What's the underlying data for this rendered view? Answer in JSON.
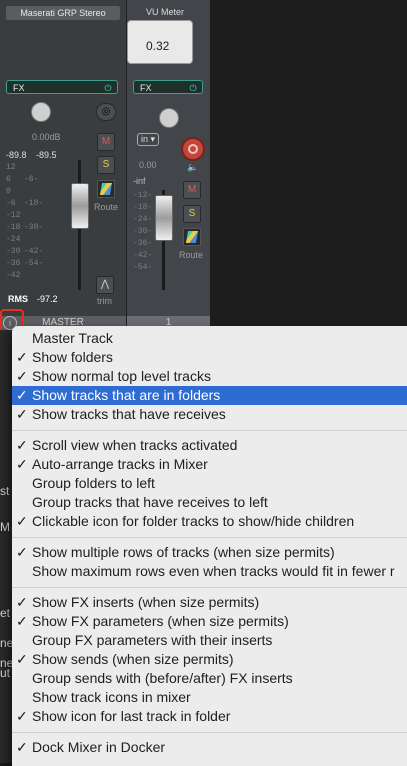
{
  "mixer": {
    "master": {
      "fx_name": "Maserati GRP Stereo",
      "fx_label": "FX",
      "volume": "0.00dB",
      "peak_left": "-89.8",
      "peak_right": "-89.5",
      "mute_label": "M",
      "solo_label": "S",
      "route_label": "Route",
      "trim_label": "trim",
      "rms_label": "RMS",
      "rms_value": "-97.2",
      "name": "MASTER",
      "scale_left": "12\n6\n0\n-6\n-12\n-18\n-24\n-30\n-36\n-42",
      "scale_right": "\n-6-\n\n-18-\n\n-30-\n\n-42-\n-54-"
    },
    "track1": {
      "vu_title": "VU Meter",
      "vu_value": "0.32",
      "fx_label": "FX",
      "input_label": "in",
      "volume": "0.00",
      "inf_label": "-inf",
      "mute_label": "M",
      "solo_label": "S",
      "route_label": "Route",
      "number": "1",
      "scale": "-12-\n-18-\n-24-\n-30-\n-36-\n-42-\n-54-"
    },
    "colors": {
      "fx_accent": "#47d3b1",
      "mute": "#e4584c",
      "solo": "#e7cf4a",
      "highlight": "#2e6bd2",
      "annotation": "#ee2b1e"
    }
  },
  "menu": {
    "items": [
      {
        "checked": false,
        "label": "Master Track"
      },
      {
        "checked": true,
        "label": "Show folders"
      },
      {
        "checked": true,
        "label": "Show normal top level tracks"
      },
      {
        "checked": true,
        "label": "Show tracks that are in folders",
        "highlighted": true
      },
      {
        "checked": true,
        "label": "Show tracks that have receives"
      },
      {
        "checked": true,
        "label": "Scroll view when tracks activated"
      },
      {
        "checked": true,
        "label": "Auto-arrange tracks in Mixer"
      },
      {
        "checked": false,
        "label": "Group folders to left"
      },
      {
        "checked": false,
        "label": "Group tracks that have receives to left"
      },
      {
        "checked": true,
        "label": "Clickable icon for folder tracks to show/hide children"
      },
      {
        "checked": true,
        "label": "Show multiple rows of tracks (when size permits)"
      },
      {
        "checked": false,
        "label": "Show maximum rows even when tracks would fit in fewer r"
      },
      {
        "checked": true,
        "label": "Show FX inserts (when size permits)"
      },
      {
        "checked": true,
        "label": "Show FX parameters (when size permits)"
      },
      {
        "checked": false,
        "label": "Group FX parameters with their inserts"
      },
      {
        "checked": true,
        "label": "Show sends (when size permits)"
      },
      {
        "checked": false,
        "label": "Group sends with (before/after) FX inserts"
      },
      {
        "checked": false,
        "label": "Show track icons in mixer"
      },
      {
        "checked": true,
        "label": "Show icon for last track in folder"
      },
      {
        "checked": true,
        "label": "Dock Mixer in Docker"
      }
    ],
    "check_glyph": "✓"
  },
  "left_leak": [
    "st",
    "M",
    "et",
    "ne",
    "ne",
    "ut"
  ]
}
